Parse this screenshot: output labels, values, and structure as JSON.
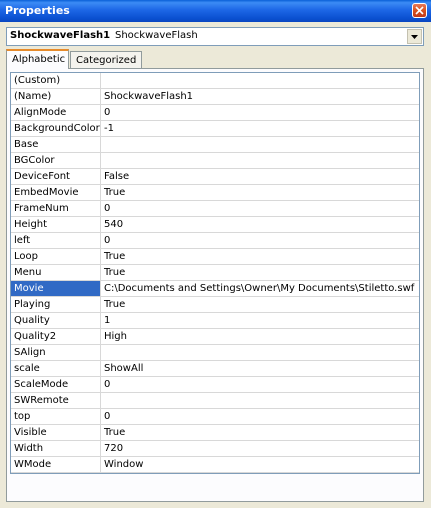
{
  "window": {
    "title": "Properties"
  },
  "object_selector": {
    "name": "ShockwaveFlash1",
    "type": "ShockwaveFlash"
  },
  "tabs": [
    {
      "label": "Alphabetic",
      "active": true
    },
    {
      "label": "Categorized",
      "active": false
    }
  ],
  "properties": [
    {
      "name": "(Custom)",
      "value": ""
    },
    {
      "name": "(Name)",
      "value": "ShockwaveFlash1"
    },
    {
      "name": "AlignMode",
      "value": "0"
    },
    {
      "name": "BackgroundColor",
      "value": "-1"
    },
    {
      "name": "Base",
      "value": ""
    },
    {
      "name": "BGColor",
      "value": ""
    },
    {
      "name": "DeviceFont",
      "value": "False"
    },
    {
      "name": "EmbedMovie",
      "value": "True"
    },
    {
      "name": "FrameNum",
      "value": "0"
    },
    {
      "name": "Height",
      "value": "540"
    },
    {
      "name": "left",
      "value": "0"
    },
    {
      "name": "Loop",
      "value": "True"
    },
    {
      "name": "Menu",
      "value": "True"
    },
    {
      "name": "Movie",
      "value": "C:\\Documents and Settings\\Owner\\My Documents\\Stiletto.swf",
      "selected": true
    },
    {
      "name": "Playing",
      "value": "True"
    },
    {
      "name": "Quality",
      "value": "1"
    },
    {
      "name": "Quality2",
      "value": "High"
    },
    {
      "name": "SAlign",
      "value": ""
    },
    {
      "name": "scale",
      "value": "ShowAll"
    },
    {
      "name": "ScaleMode",
      "value": "0"
    },
    {
      "name": "SWRemote",
      "value": ""
    },
    {
      "name": "top",
      "value": "0"
    },
    {
      "name": "Visible",
      "value": "True"
    },
    {
      "name": "Width",
      "value": "720"
    },
    {
      "name": "WMode",
      "value": "Window"
    }
  ],
  "colors": {
    "selection": "#316ac5",
    "titlebar": "#0a4fcf",
    "active_tab_accent": "#e68b2c"
  }
}
